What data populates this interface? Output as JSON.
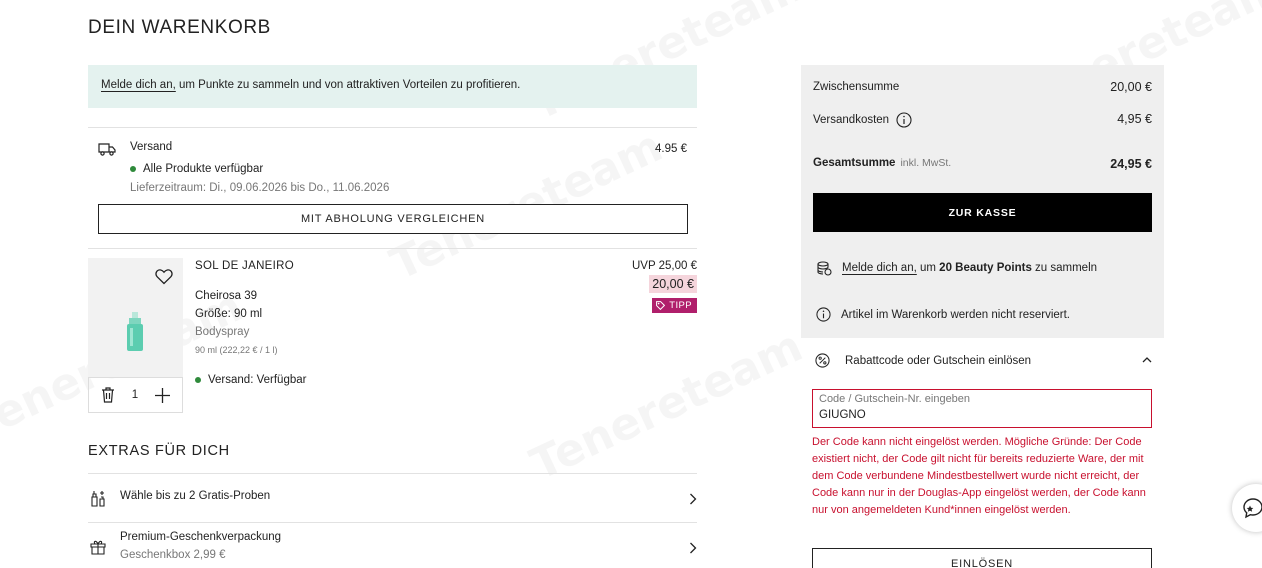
{
  "cart": {
    "title": "DEIN WARENKORB",
    "login_banner": {
      "link": "Melde dich an,",
      "text": " um Punkte zu sammeln und von attraktiven Vorteilen zu profitieren."
    }
  },
  "shipping": {
    "title": "Versand",
    "price": "4.95 €",
    "availability": "Alle Produkte verfügbar",
    "period": "Lieferzeitraum: Di., 09.06.2026 bis Do., 11.06.2026",
    "compare_button": "MIT ABHOLUNG VERGLEICHEN"
  },
  "product": {
    "brand": "SOL DE JANEIRO",
    "name": "Cheirosa 39",
    "size": "Größe: 90 ml",
    "type": "Bodyspray",
    "unit_price": "90 ml (222,22 € / 1 l)",
    "availability": "Versand: Verfügbar",
    "uvp": "UVP 25,00 €",
    "price": "20,00 €",
    "badge": "TIPP",
    "quantity": "1"
  },
  "extras": {
    "title": "EXTRAS FÜR DICH",
    "items": [
      {
        "title": "Wähle bis zu 2 Gratis-Proben",
        "subtitle": ""
      },
      {
        "title": "Premium-Geschenkverpackung",
        "subtitle": "Geschenkbox 2,99 €"
      }
    ]
  },
  "summary": {
    "subtotal_label": "Zwischensumme",
    "subtotal_value": "20,00 €",
    "shipping_label": "Versandkosten",
    "shipping_value": "4,95 €",
    "total_label": "Gesamtsumme",
    "total_note": "inkl. MwSt.",
    "total_value": "24,95 €",
    "checkout_button": "ZUR KASSE",
    "points_link": "Melde dich an,",
    "points_pre": " um ",
    "points_bold": "20 Beauty Points",
    "points_post": " zu sammeln",
    "reserve_note": "Artikel im Warenkorb werden nicht reserviert."
  },
  "voucher": {
    "title": "Rabattcode oder Gutschein einlösen",
    "placeholder": "Code / Gutschein-Nr. eingeben",
    "value": "GIUGNO",
    "error": "Der Code kann nicht eingelöst werden. Mögliche Gründe: Der Code existiert nicht, der Code gilt nicht für bereits reduzierte Ware, der mit dem Code verbundene Mindestbestellwert wurde nicht erreicht, der Code kann nur in der Douglas-App eingelöst werden, der Code kann nur von angemeldeten Kund*innen eingelöst werden.",
    "redeem_button": "EINLÖSEN"
  },
  "watermark_text": "Tenereteam",
  "colors": {
    "banner_bg": "#e4f2ef",
    "sale_bg": "#f5d5dc",
    "tipp_bg": "#b01f6b",
    "error": "#c8102e",
    "available": "#2f8a3b",
    "summary_bg": "#efefef"
  },
  "icons": [
    "truck-icon",
    "heart-icon",
    "trash-icon",
    "plus-icon",
    "tag-icon",
    "samples-icon",
    "gift-icon",
    "chevron-right-icon",
    "info-icon",
    "points-icon",
    "percent-icon",
    "chevron-up-icon",
    "chat-icon"
  ]
}
